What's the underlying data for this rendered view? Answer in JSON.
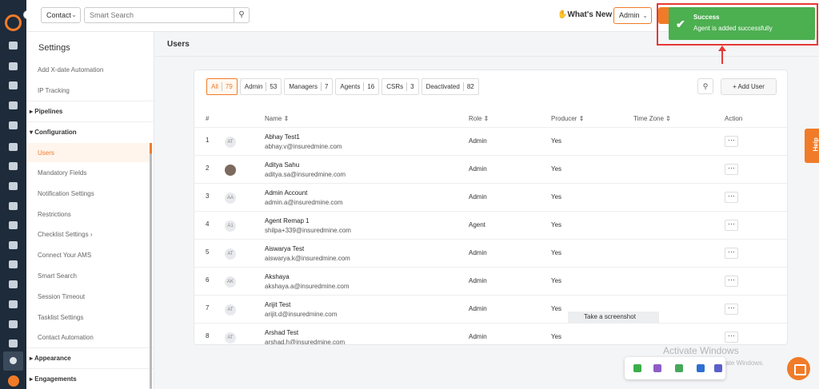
{
  "topbar": {
    "contact_type": "Contact",
    "search_placeholder": "Smart Search",
    "whats_new": "What's New",
    "role_select": "Admin"
  },
  "sidebar": {
    "title": "Settings",
    "items": [
      {
        "label": "Add X-date Automation"
      },
      {
        "label": "IP Tracking"
      },
      {
        "label": "Pipelines",
        "section": true
      },
      {
        "label": "Configuration",
        "section": true
      },
      {
        "label": "Users",
        "active": true
      },
      {
        "label": "Mandatory Fields"
      },
      {
        "label": "Notification Settings"
      },
      {
        "label": "Restrictions"
      },
      {
        "label": "Checklist Settings"
      },
      {
        "label": "Connect Your AMS"
      },
      {
        "label": "Smart Search"
      },
      {
        "label": "Session Timeout"
      },
      {
        "label": "Tasklist Settings"
      },
      {
        "label": "Contact Automation"
      },
      {
        "label": "Appearance",
        "section": true
      },
      {
        "label": "Engagements",
        "section": true
      }
    ]
  },
  "main": {
    "title": "Users",
    "filters": [
      {
        "label": "All",
        "count": "79",
        "active": true
      },
      {
        "label": "Admin",
        "count": "53"
      },
      {
        "label": "Managers",
        "count": "7"
      },
      {
        "label": "Agents",
        "count": "16"
      },
      {
        "label": "CSRs",
        "count": "3"
      },
      {
        "label": "Deactivated",
        "count": "82"
      }
    ],
    "add_user": "Add User",
    "columns": [
      "#",
      "Name",
      "Role",
      "Producer",
      "Time Zone",
      "Action"
    ],
    "rows": [
      {
        "num": "1",
        "initials": "AT",
        "name": "Abhay Test1",
        "email": "abhay.v@insuredmine.com",
        "role": "Admin",
        "producer": "Yes"
      },
      {
        "num": "2",
        "initials": "",
        "photo": true,
        "name": "Aditya Sahu",
        "email": "aditya.sa@insuredmine.com",
        "role": "Admin",
        "producer": "Yes"
      },
      {
        "num": "3",
        "initials": "AA",
        "name": "Admin Account",
        "email": "admin.a@insuredmine.com",
        "role": "Admin",
        "producer": "Yes"
      },
      {
        "num": "4",
        "initials": "A1",
        "name": "Agent Remap 1",
        "email": "shilpa+339@insuredmine.com",
        "role": "Agent",
        "producer": "Yes"
      },
      {
        "num": "5",
        "initials": "AT",
        "name": "Aiswarya Test",
        "email": "aiswarya.k@insuredmine.com",
        "role": "Admin",
        "producer": "Yes"
      },
      {
        "num": "6",
        "initials": "AK",
        "name": "Akshaya",
        "email": "akshaya.a@insuredmine.com",
        "role": "Admin",
        "producer": "Yes"
      },
      {
        "num": "7",
        "initials": "AT",
        "name": "Arijit Test",
        "email": "arijit.d@insuredmine.com",
        "role": "Admin",
        "producer": "Yes"
      },
      {
        "num": "8",
        "initials": "AT",
        "name": "Arshad Test",
        "email": "arshad.h@insuredmine.com",
        "role": "Admin",
        "producer": "Yes"
      }
    ]
  },
  "toast": {
    "title": "Success",
    "message": "Agent is added successfully"
  },
  "overlay": {
    "screenshot_tooltip": "Take a screenshot",
    "activate_title": "Activate Windows",
    "activate_sub": "Go to Settings to activate Windows.",
    "help_tab": "Help"
  },
  "colors": {
    "accent": "#f07b28",
    "success": "#4caf50",
    "highlight": "#e53935",
    "rail": "#1d2b3a"
  }
}
